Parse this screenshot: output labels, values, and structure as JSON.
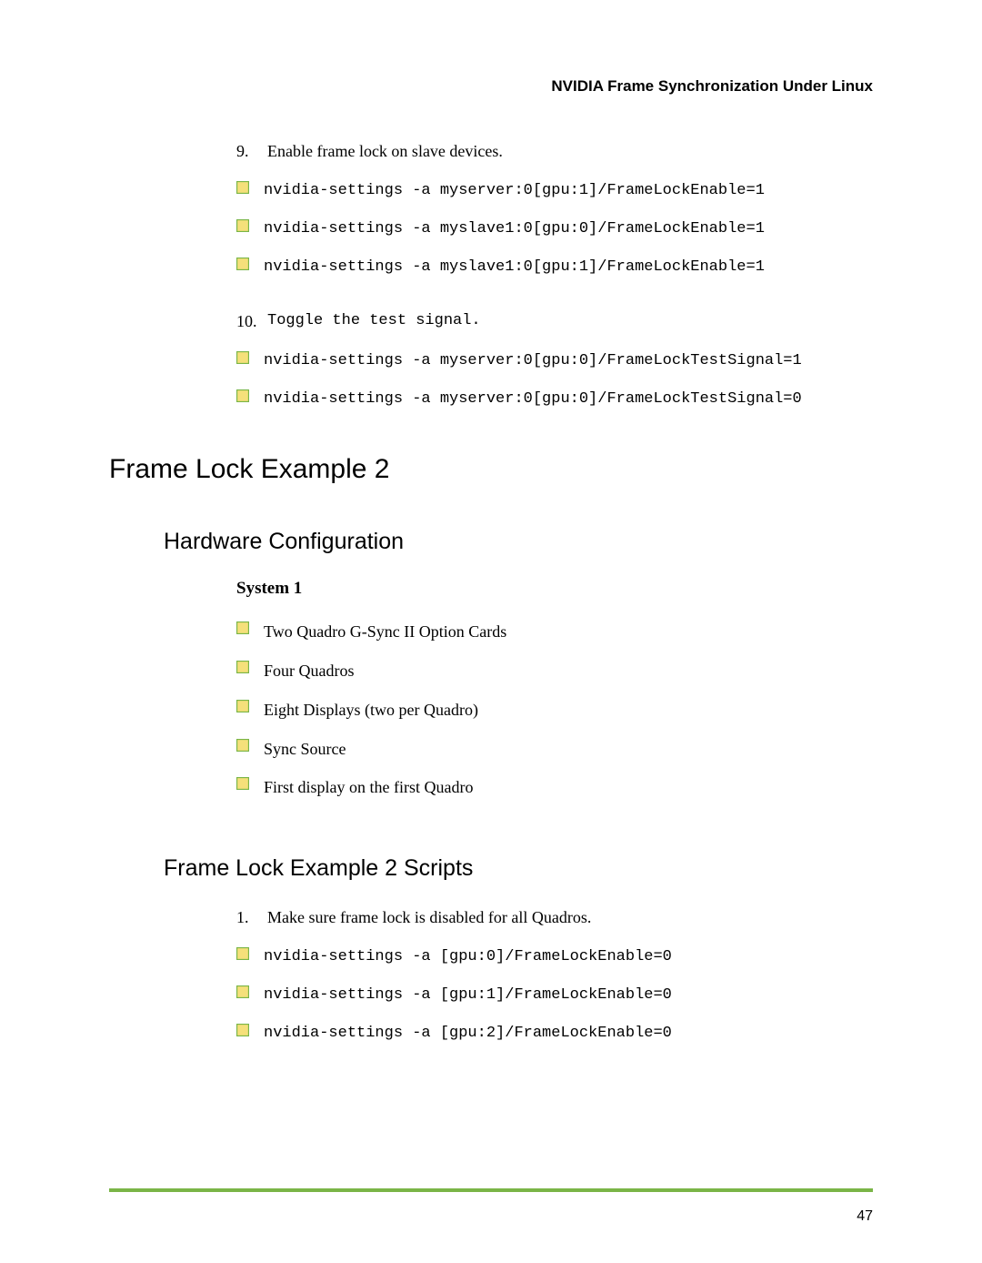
{
  "header": {
    "title": "NVIDIA Frame Synchronization Under Linux"
  },
  "items": {
    "step9_num": "9.",
    "step9_text": "Enable frame lock on slave devices.",
    "cmd1": "nvidia-settings -a myserver:0[gpu:1]/FrameLockEnable=1",
    "cmd2": "nvidia-settings -a myslave1:0[gpu:0]/FrameLockEnable=1",
    "cmd3": "nvidia-settings -a myslave1:0[gpu:1]/FrameLockEnable=1",
    "step10_num": "10.",
    "step10_text": "Toggle the test signal.",
    "cmd4": "nvidia-settings -a myserver:0[gpu:0]/FrameLockTestSignal=1",
    "cmd5": "nvidia-settings -a myserver:0[gpu:0]/FrameLockTestSignal=0"
  },
  "headings": {
    "h1a": "Frame Lock Example 2",
    "h2a": "Hardware Configuration",
    "h3a": "System 1",
    "h2b": "Frame Lock Example 2 Scripts"
  },
  "hw": {
    "b1": "Two Quadro G-Sync II Option Cards",
    "b2": "Four Quadros",
    "b3": "Eight Displays (two per Quadro)",
    "b4": "Sync Source",
    "b5": "First display on the first Quadro"
  },
  "scripts": {
    "step1_num": "1.",
    "step1_text": "Make sure frame lock is disabled for all Quadros.",
    "s1": "nvidia-settings -a [gpu:0]/FrameLockEnable=0",
    "s2": "nvidia-settings -a [gpu:1]/FrameLockEnable=0",
    "s3": "nvidia-settings -a [gpu:2]/FrameLockEnable=0"
  },
  "footer": {
    "page": "47"
  }
}
